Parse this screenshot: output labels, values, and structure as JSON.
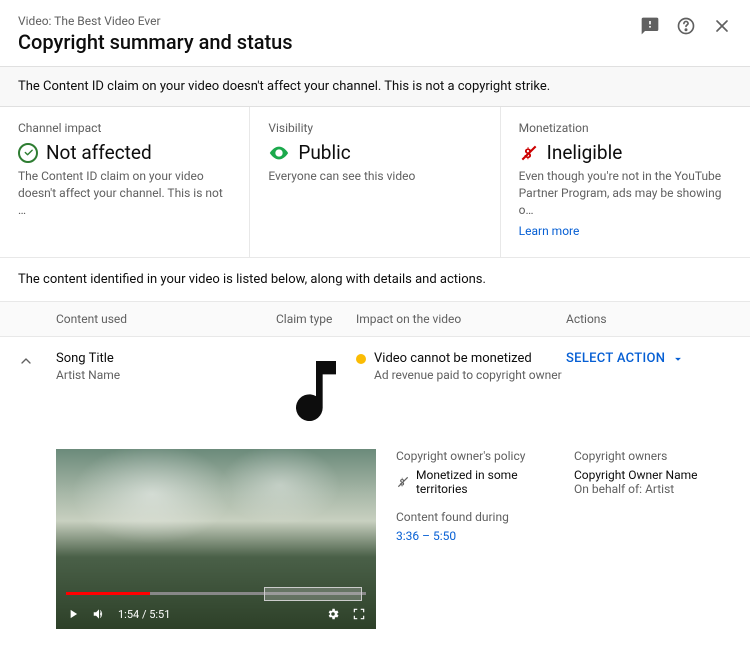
{
  "header": {
    "video_prefix": "Video: The Best Video Ever",
    "title": "Copyright summary and status"
  },
  "banner": "The Content ID claim on your video doesn't affect your channel. This is not a copyright strike.",
  "status": {
    "impact": {
      "label": "Channel impact",
      "value": "Not affected",
      "desc": "The Content ID claim on your video doesn't affect your channel. This is not …"
    },
    "visibility": {
      "label": "Visibility",
      "value": "Public",
      "desc": "Everyone can see this video"
    },
    "monetization": {
      "label": "Monetization",
      "value": "Ineligible",
      "desc": "Even though you're not in the YouTube Partner Program, ads may be showing o…",
      "learn": "Learn more"
    }
  },
  "list_intro": "The content identified in your video is listed below, along with details and actions.",
  "table": {
    "cols": {
      "content": "Content used",
      "claim": "Claim type",
      "impact": "Impact on the video",
      "actions": "Actions"
    }
  },
  "row": {
    "title": "Song Title",
    "artist": "Artist Name",
    "impact_title": "Video cannot be monetized",
    "impact_sub": "Ad revenue paid to copyright owner",
    "action_label": "SELECT ACTION",
    "policy_label": "Copyright owner's policy",
    "policy_value": "Monetized in some territories",
    "found_label": "Content found during",
    "found_value": "3:36 – 5:50",
    "owners_label": "Copyright owners",
    "owner_name": "Copyright Owner Name",
    "owner_behalf": "On behalf of: Artist",
    "player_time": "1:54 / 5:51"
  }
}
